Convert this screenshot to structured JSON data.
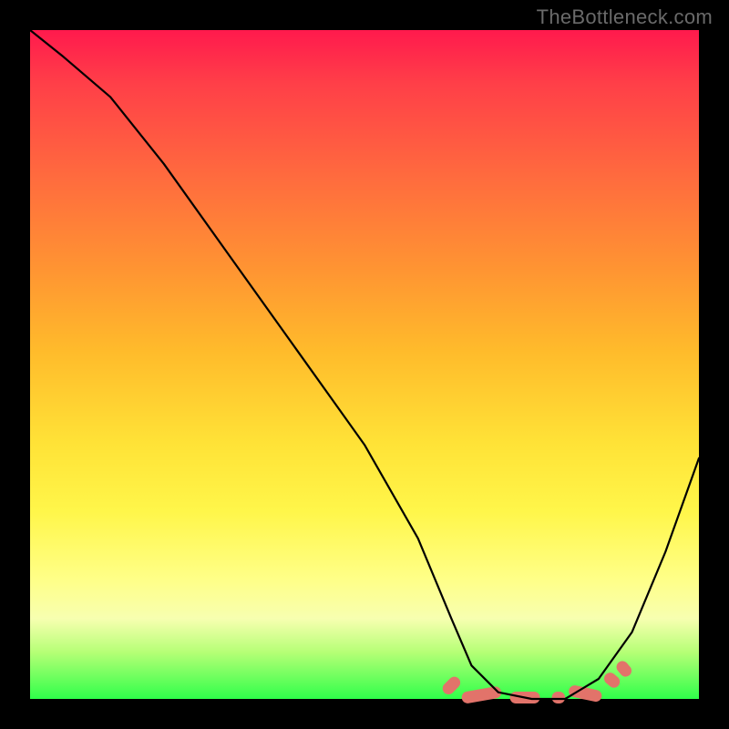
{
  "watermark": "TheBottleneck.com",
  "chart_data": {
    "type": "line",
    "title": "",
    "xlabel": "",
    "ylabel": "",
    "xlim": [
      0,
      100
    ],
    "ylim": [
      0,
      100
    ],
    "grid": false,
    "series": [
      {
        "name": "bottleneck-curve",
        "x": [
          0,
          5,
          12,
          20,
          30,
          40,
          50,
          58,
          63,
          66,
          70,
          75,
          80,
          85,
          90,
          95,
          100
        ],
        "y": [
          100,
          96,
          90,
          80,
          66,
          52,
          38,
          24,
          12,
          5,
          1,
          0,
          0,
          3,
          10,
          22,
          36
        ]
      }
    ],
    "markers": {
      "name": "highlight-segments",
      "color": "#e2736a",
      "items": [
        {
          "cx": 63.0,
          "cy": 2.0,
          "w": 3.0,
          "rot": -45
        },
        {
          "cx": 67.5,
          "cy": 0.6,
          "w": 6.0,
          "rot": -10
        },
        {
          "cx": 74.0,
          "cy": 0.2,
          "w": 4.5,
          "rot": 0
        },
        {
          "cx": 79.0,
          "cy": 0.2,
          "w": 2.0,
          "rot": 0
        },
        {
          "cx": 83.0,
          "cy": 0.8,
          "w": 5.0,
          "rot": 12
        },
        {
          "cx": 87.0,
          "cy": 2.8,
          "w": 2.5,
          "rot": 40
        },
        {
          "cx": 88.8,
          "cy": 4.5,
          "w": 2.5,
          "rot": 50
        }
      ]
    }
  }
}
